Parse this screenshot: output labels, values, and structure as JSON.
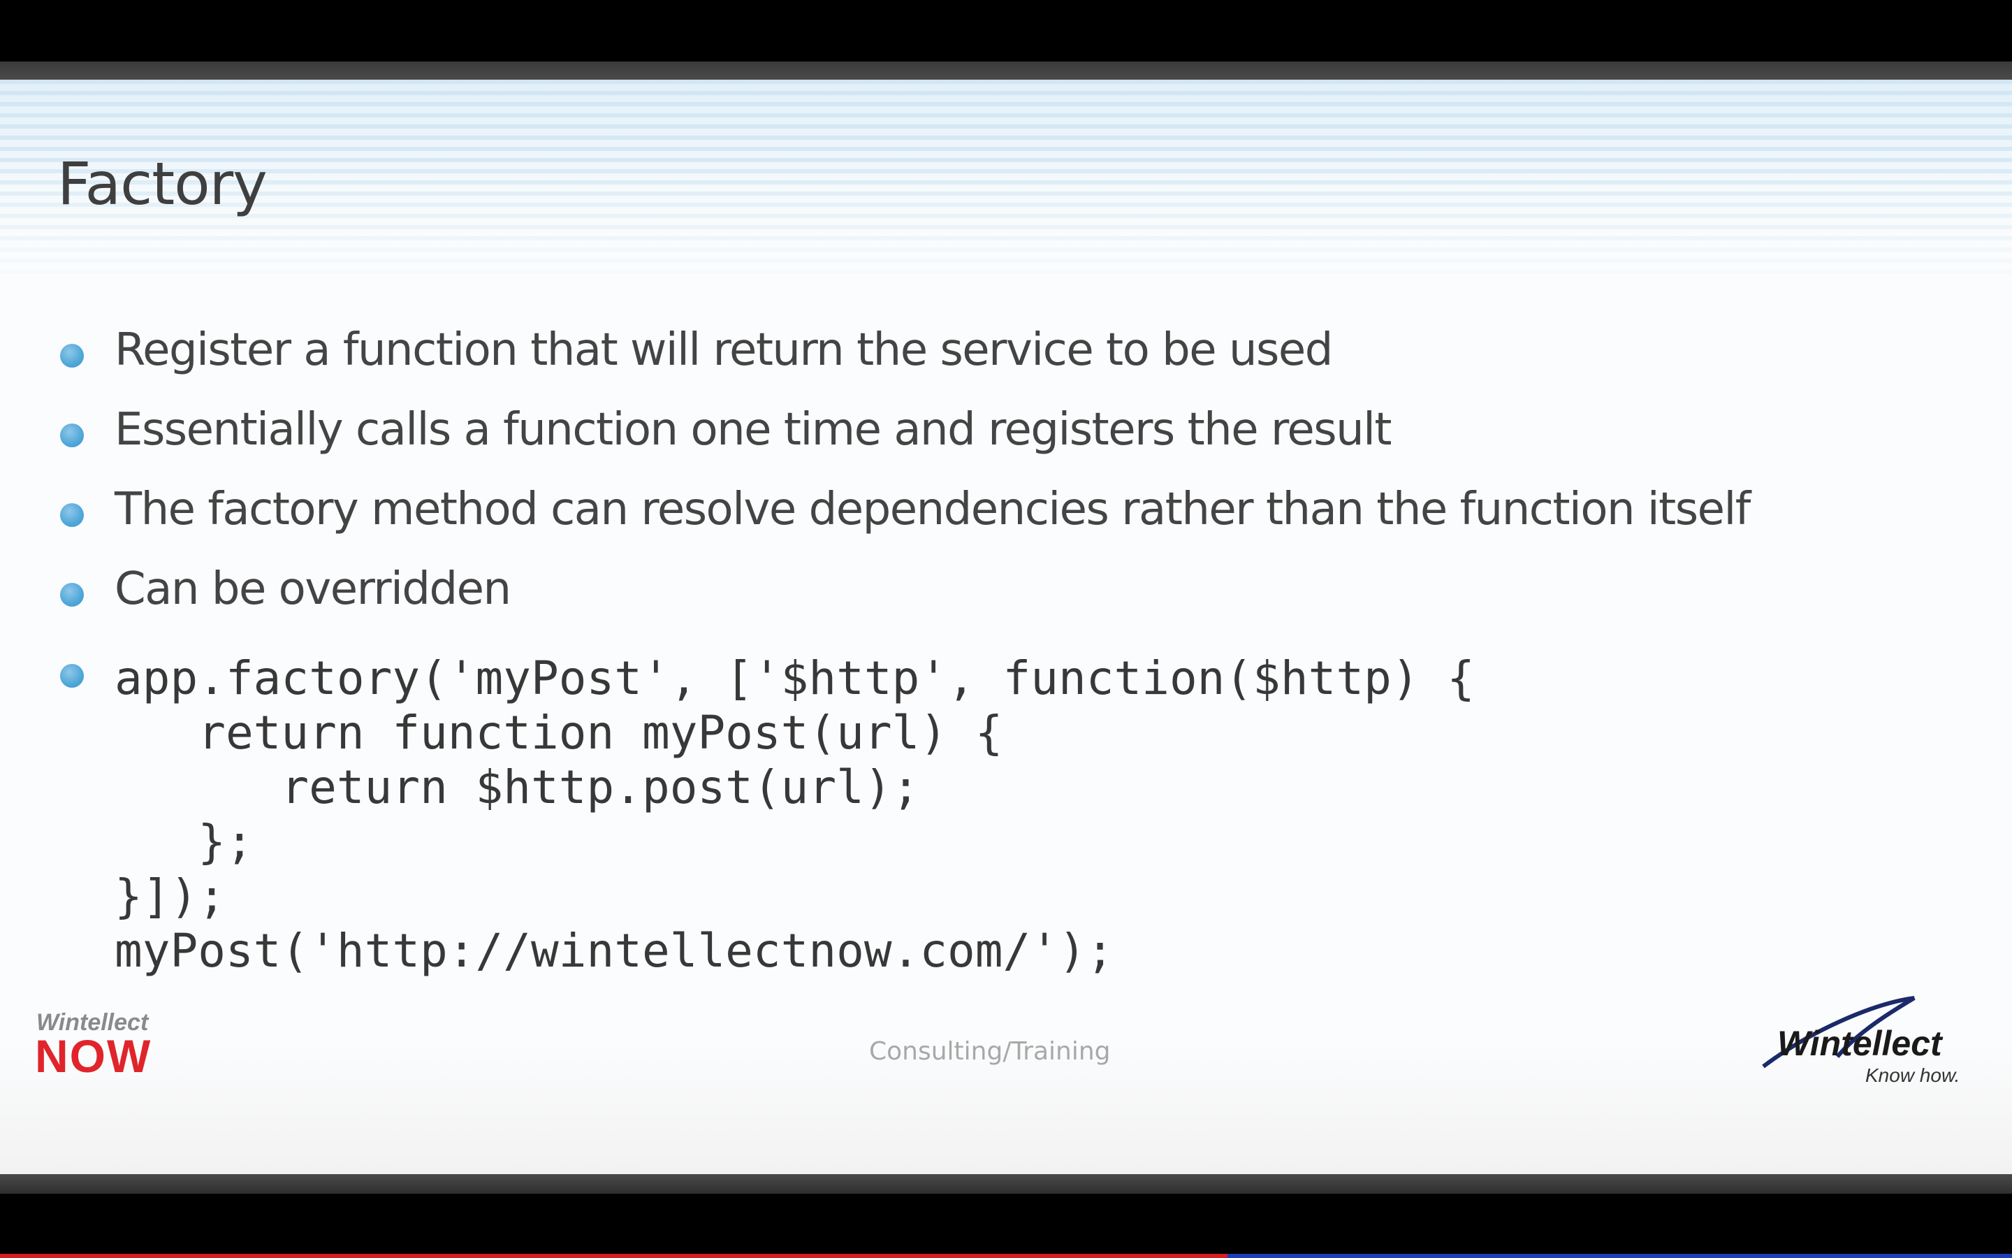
{
  "slide": {
    "title": "Factory",
    "bullets": [
      "Register a function that will return the service to be used",
      "Essentially calls a function one time and registers the result",
      "The factory method can resolve dependencies rather than the function itself",
      "Can be overridden"
    ],
    "code_lines": [
      "app.factory('myPost', ['$http', function($http) {",
      "   return function myPost(url) {",
      "      return $http.post(url);",
      "   };",
      "}]);",
      "myPost('http://wintellectnow.com/');"
    ]
  },
  "footer": {
    "left_logo": {
      "top_text": "Wintellect",
      "bottom_text": "NOW"
    },
    "center_text": "Consulting/Training",
    "right_logo": {
      "brand": "Wintellect",
      "tagline": "Know how."
    }
  },
  "video": {
    "progress_fraction": 0.61
  },
  "colors": {
    "bullet_blue": "#4fa6d8",
    "now_red": "#e0242b",
    "progress_red": "#d61f1f",
    "progress_blue": "#1e3db8"
  },
  "icons": [
    "bullet-dot-icon",
    "wintellect-now-logo",
    "wintellect-swoosh-logo"
  ]
}
